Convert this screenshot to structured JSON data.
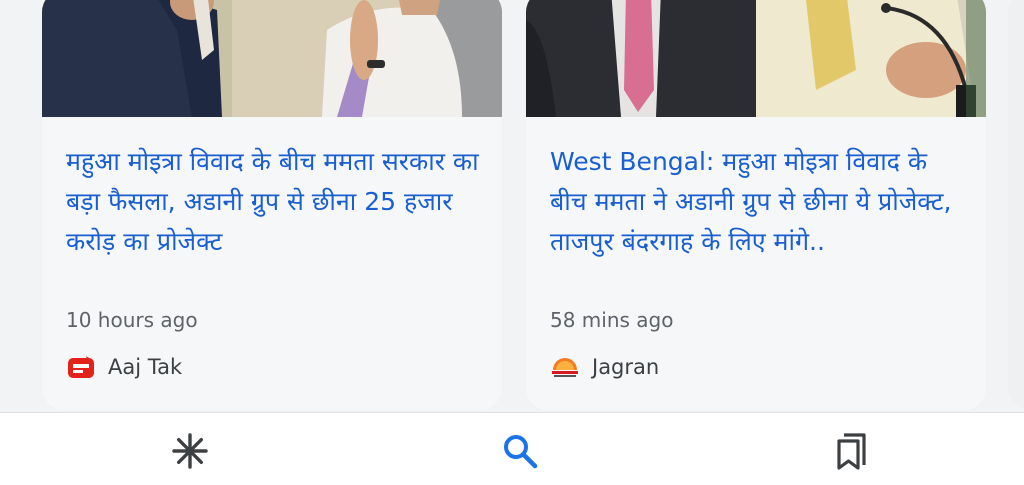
{
  "articles": [
    {
      "headline": "महुआ मोइत्रा विवाद के बीच ममता सरकार का बड़ा फैसला, अडानी ग्रुप से छीना 25 हजार करोड़ का प्रोजेक्ट",
      "time": "10 hours ago",
      "source": "Aaj Tak",
      "source_logo_icon": "aaj-tak-logo",
      "source_logo_color": "#e2231a"
    },
    {
      "headline": "West Bengal: महुआ मोइत्रा विवाद के बीच ममता ने अडानी ग्रुप से छीना ये प्रोजेक्ट, ताजपुर बंदरगाह के लिए मांगे..",
      "time": "58 mins ago",
      "source": "Jagran",
      "source_logo_icon": "jagran-logo",
      "source_logo_color": "#f47b20"
    }
  ],
  "bottom_nav": [
    {
      "icon": "discover-asterisk-icon",
      "active": false
    },
    {
      "icon": "search-icon",
      "active": true,
      "color": "#1a73e8"
    },
    {
      "icon": "saved-collections-icon",
      "active": false
    }
  ],
  "colors": {
    "headline": "#1a5fd0",
    "meta_text": "#5f6368",
    "card_bg": "#f6f7f9",
    "accent": "#1a73e8"
  }
}
